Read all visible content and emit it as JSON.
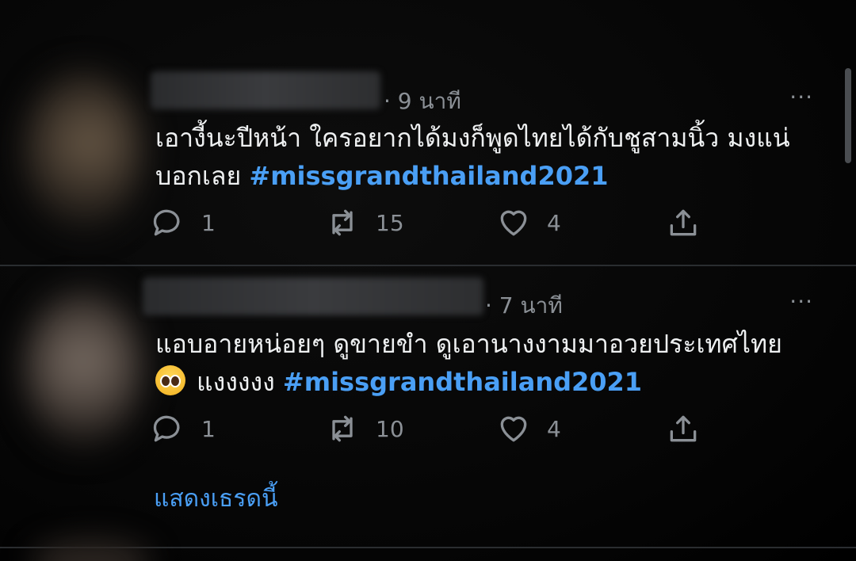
{
  "tweets": [
    {
      "timestamp": "· 9 นาที",
      "more": "···",
      "text": "เอางี้นะปีหน้า ใครอยากได้มงก็พูดไทยได้กับชูสามนิ้ว มงแน่บอกเลย",
      "hashtag": "#missgrandthailand2021",
      "replies": "1",
      "retweets": "15",
      "likes": "4"
    },
    {
      "timestamp": "· 7 นาที",
      "more": "···",
      "text": "แอบอายหน่อยๆ ดูขายขำ ดูเอานางงามมาอวยประเทศไทย",
      "text2": "แงงงงง",
      "emoji": "pleading-face-emoji",
      "hashtag": "#missgrandthailand2021",
      "replies": "1",
      "retweets": "10",
      "likes": "4"
    }
  ],
  "show_thread_label": "แสดงเธรดนี้",
  "colors": {
    "background": "#050505",
    "text": "#eef0f1",
    "muted": "#8b9096",
    "accent": "#4a9ff5",
    "divider": "#2a2d30"
  },
  "icons": [
    "reply-icon",
    "retweet-icon",
    "like-icon",
    "share-icon",
    "more-icon"
  ]
}
